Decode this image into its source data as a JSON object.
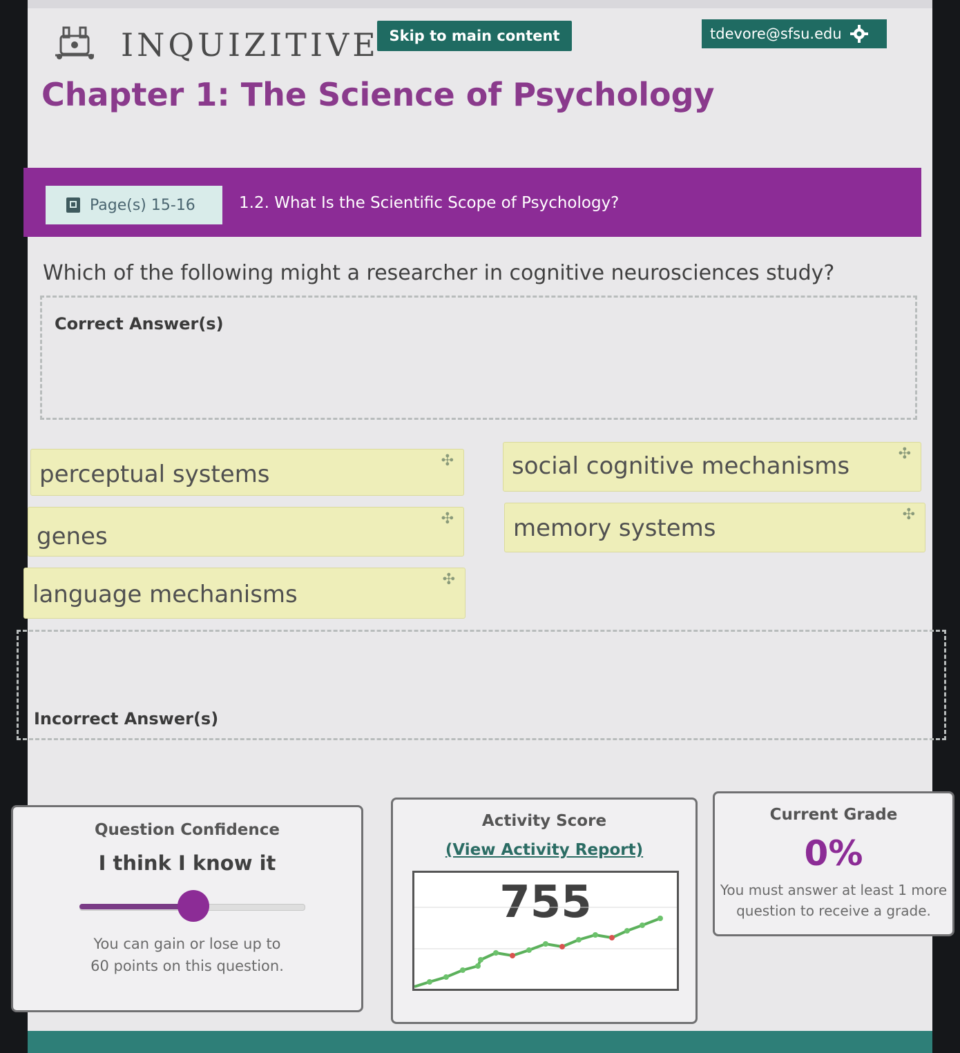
{
  "header": {
    "brand": "INQUIZITIVE",
    "skip_link": "Skip to main content",
    "user_email": "tdevore@sfsu.edu",
    "settings_icon": "gear-icon",
    "logo_icon": "quizzer-logo-icon"
  },
  "chapter_title": "Chapter 1: The Science of Psychology",
  "section_band": {
    "pages_label": "Page(s) 15-16",
    "pages_icon": "book-icon",
    "section_title": "1.2. What Is the Scientific Scope of Psychology?"
  },
  "question": "Which of the following might a researcher in cognitive neurosciences study?",
  "correct_zone_title": "Correct Answer(s)",
  "incorrect_zone_title": "Incorrect Answer(s)",
  "answers": [
    {
      "label": "perceptual systems",
      "icon": "drag-handle-icon"
    },
    {
      "label": "social cognitive mechanisms",
      "icon": "drag-handle-icon"
    },
    {
      "label": "genes",
      "icon": "drag-handle-icon"
    },
    {
      "label": "memory systems",
      "icon": "drag-handle-icon"
    },
    {
      "label": "language mechanisms",
      "icon": "drag-handle-icon"
    }
  ],
  "confidence": {
    "title": "Question Confidence",
    "value": "I think I know it",
    "slider_level": 0.5,
    "note_line1": "You can gain or lose up to",
    "note_line2": "60 points on this question."
  },
  "activity": {
    "title": "Activity Score",
    "report_link": "(View Activity Report)",
    "score": "755",
    "colors": {
      "up": "#6cc26c",
      "down": "#d9534f"
    }
  },
  "grade": {
    "title": "Current Grade",
    "value": "0%",
    "note_line1": "You must answer at least 1 more",
    "note_line2": "question to receive a grade."
  },
  "colors": {
    "brand_purple": "#8c2c96",
    "teal": "#1f6b62",
    "card_yellow": "#eeeeb9"
  }
}
